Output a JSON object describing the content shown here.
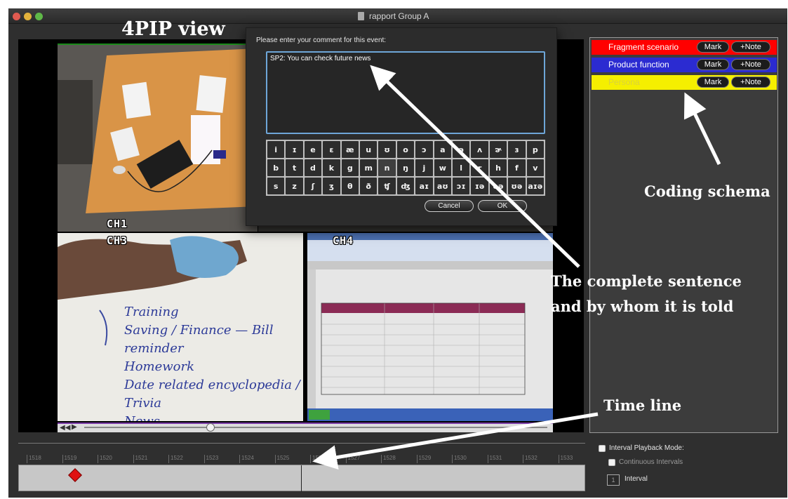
{
  "window": {
    "title": "rapport Group A"
  },
  "video": {
    "channels": {
      "ch1": "CH1",
      "ch3": "CH3",
      "ch4": "CH4"
    },
    "whiteboard_lines": [
      "Training",
      "Saving / Finance — Bill reminder",
      "Homework",
      "Date related encyclopedia / Trivia",
      "News"
    ]
  },
  "dialog": {
    "prompt": "Please enter your comment for this event:",
    "comment": "SP2: You can check future news",
    "keyboard": [
      [
        "i",
        "ɪ",
        "e",
        "ɛ",
        "æ",
        "u",
        "ʊ",
        "o",
        "ɔ",
        "a",
        "ə",
        "ʌ",
        "ɚ",
        "ɜ",
        "p"
      ],
      [
        "b",
        "t",
        "d",
        "k",
        "g",
        "m",
        "n",
        "ŋ",
        "j",
        "w",
        "l",
        "r",
        "h",
        "f",
        "v"
      ],
      [
        "s",
        "z",
        "ʃ",
        "ʒ",
        "θ",
        "ð",
        "ʧ",
        "ʤ",
        "aɪ",
        "aʊ",
        "ɔɪ",
        "ɪə",
        "eə",
        "ʊə",
        "aɪə"
      ]
    ],
    "cancel_label": "Cancel",
    "ok_label": "OK"
  },
  "schema": {
    "rows": [
      {
        "name": "Fragment scenario",
        "bg": "#ff0000",
        "fg": "#ffffff",
        "mark_label": "Mark",
        "note_label": "+Note"
      },
      {
        "name": "Product function",
        "bg": "#2b2bd1",
        "fg": "#ffffff",
        "mark_label": "Mark",
        "note_label": "+Note"
      },
      {
        "name": "Persona",
        "bg": "#f5ef00",
        "fg": "#d8d040",
        "mark_label": "Mark",
        "note_label": "+Note"
      }
    ]
  },
  "timeline": {
    "ticks": [
      "1518",
      "1519",
      "1520",
      "1521",
      "1522",
      "1523",
      "1524",
      "1525",
      "1526",
      "1527",
      "1528",
      "1529",
      "1530",
      "1531",
      "1532",
      "1533"
    ]
  },
  "interval": {
    "playback_mode_label": "Interval Playback Mode:",
    "continuous_label": "Continuous Intervals",
    "interval_value": "1",
    "interval_label": "Interval"
  },
  "annotations": {
    "pip_view": "4PIP view",
    "coding_schema": "Coding schema",
    "sentence_line1": "The complete sentence",
    "sentence_line2": "and by whom it is told",
    "time_line": "Time line"
  },
  "colors": {
    "comment_border": "#6ea6d8",
    "event_marker": "#e01010"
  }
}
